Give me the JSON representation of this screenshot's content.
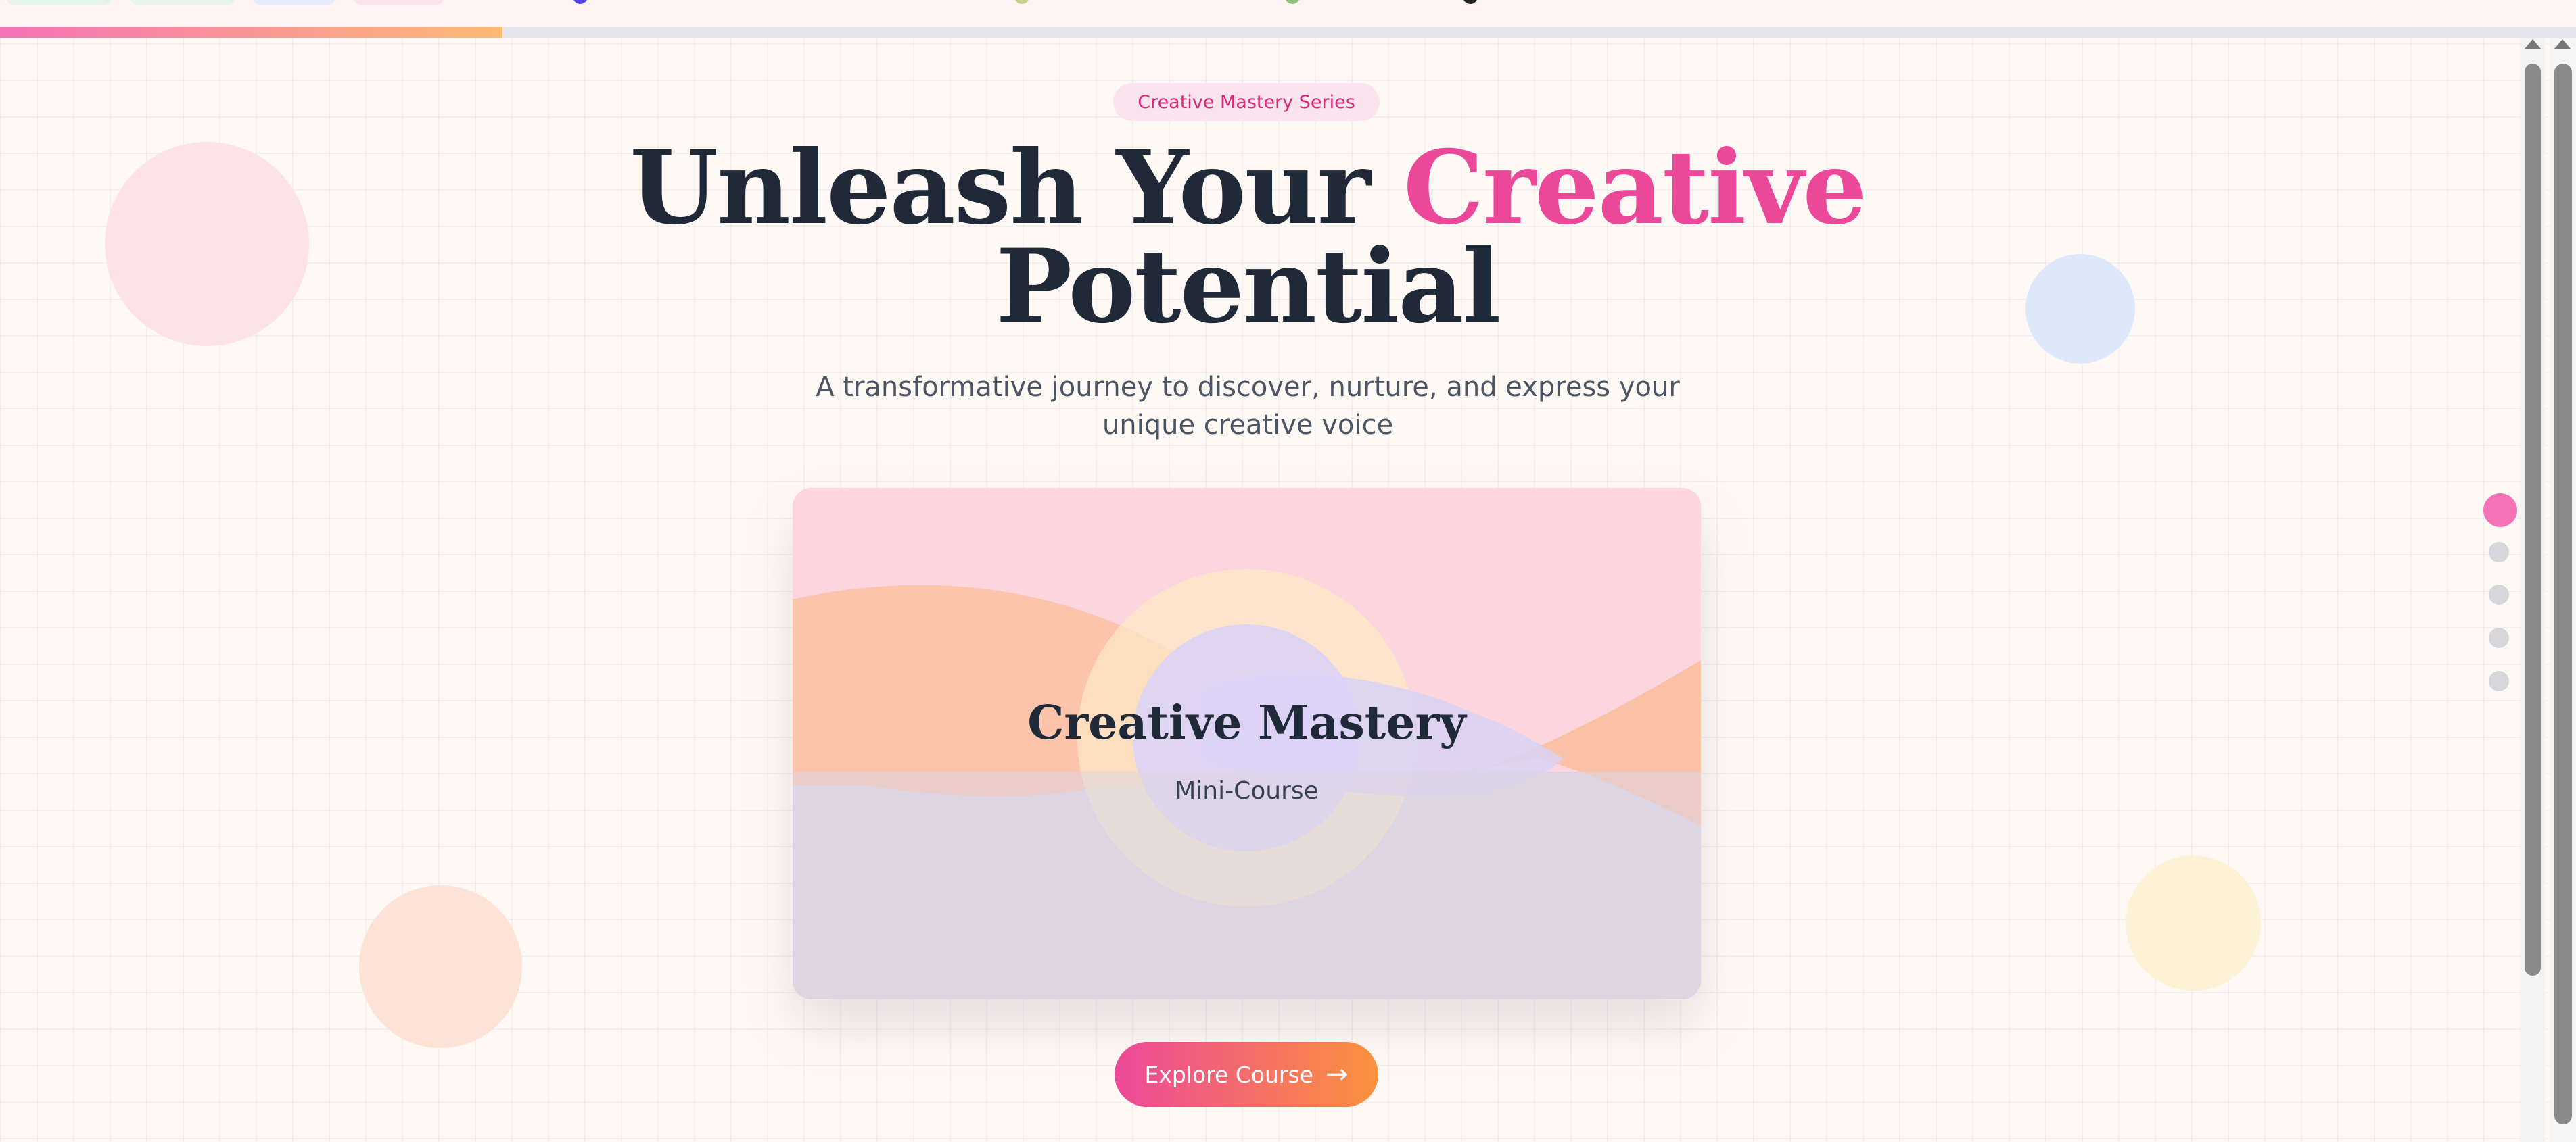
{
  "progress": {
    "percent": 19.5,
    "fill_from": "#f472b6",
    "fill_to": "#fdba74"
  },
  "hero": {
    "badge": "Creative Mastery Series",
    "title_part1": "Unleash Your ",
    "title_accent": "Creative",
    "title_part2": "Potential",
    "subtitle": "A transformative journey to discover, nurture, and express your unique creative voice"
  },
  "card": {
    "title": "Creative Mastery",
    "subtitle": "Mini-Course"
  },
  "cta": {
    "label": "Explore Course",
    "icon": "arrow-right-icon"
  },
  "section_nav": {
    "count": 5,
    "active_index": 0
  },
  "colors": {
    "accent_pink": "#ec4899",
    "accent_orange": "#fb923c",
    "heading": "#1f2937",
    "badge_bg": "#fce4ef",
    "background": "#fff9f6"
  }
}
